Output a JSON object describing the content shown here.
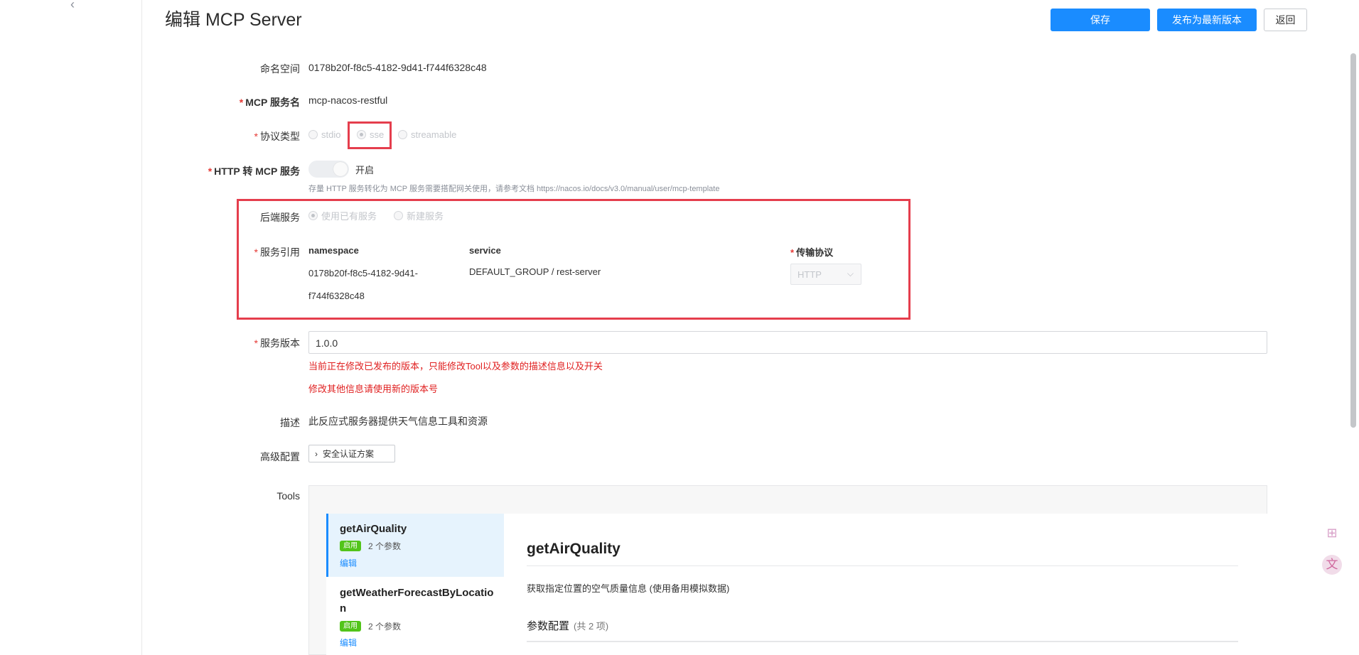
{
  "header": {
    "title": "编辑 MCP Server",
    "save_label": "保存",
    "publish_label": "发布为最新版本",
    "back_label": "返回"
  },
  "form": {
    "namespace": {
      "label": "命名空间",
      "value": "0178b20f-f8c5-4182-9d41-f744f6328c48"
    },
    "service_name": {
      "label": "MCP 服务名",
      "value": "mcp-nacos-restful"
    },
    "protocol": {
      "label": "协议类型",
      "options": [
        "stdio",
        "sse",
        "streamable"
      ],
      "selected": "sse"
    },
    "http_to_mcp": {
      "label": "HTTP 转 MCP 服务",
      "toggle_label": "开启",
      "enabled": true,
      "help": "存量 HTTP 服务转化为 MCP 服务需要搭配网关使用，请参考文档 https://nacos.io/docs/v3.0/manual/user/mcp-template"
    },
    "backend": {
      "label": "后端服务",
      "options": [
        "使用已有服务",
        "新建服务"
      ],
      "selected": "使用已有服务"
    },
    "service_ref": {
      "label": "服务引用",
      "namespace_header": "namespace",
      "service_header": "service",
      "protocol_header": "传输协议",
      "namespace_value_line1": "0178b20f-f8c5-4182-9d41-",
      "namespace_value_line2": "f744f6328c48",
      "service_value": "DEFAULT_GROUP / rest-server",
      "protocol_value": "HTTP"
    },
    "version": {
      "label": "服务版本",
      "value": "1.0.0",
      "warning1": "当前正在修改已发布的版本，只能修改Tool以及参数的描述信息以及开关",
      "warning2": "修改其他信息请使用新的版本号"
    },
    "description": {
      "label": "描述",
      "value": "此反应式服务器提供天气信息工具和资源"
    },
    "advanced": {
      "label": "高级配置",
      "button_label": "安全认证方案"
    }
  },
  "tools": {
    "label": "Tools",
    "items": [
      {
        "name": "getAirQuality",
        "badge": "启用",
        "params": "2 个参数",
        "edit": "编辑"
      },
      {
        "name_line1": "getWeatherForecastByLocatio",
        "name_line2": "n",
        "badge": "启用",
        "params": "2 个参数",
        "edit": "编辑"
      }
    ],
    "detail": {
      "title": "getAirQuality",
      "description": "获取指定位置的空气质量信息 (使用备用模拟数据)",
      "param_title": "参数配置",
      "param_count": "(共 2 项)"
    }
  },
  "colors": {
    "primary": "#1a8cff",
    "required": "#e53935",
    "warning": "#e02020",
    "highlight": "#e53e4d",
    "badge": "#52c41a"
  },
  "icons": [
    "collapse-icon",
    "chevron-right-icon",
    "chevron-down-icon",
    "apps-icon",
    "translate-icon"
  ]
}
